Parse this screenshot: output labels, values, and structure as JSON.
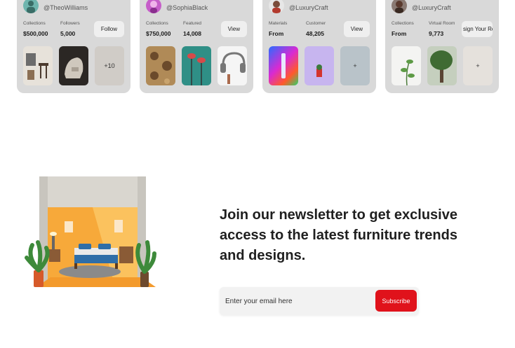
{
  "cards": [
    {
      "handle": "@TheoWilliams",
      "stats": [
        {
          "label": "Collections",
          "value": "$500,000"
        },
        {
          "label": "Followers",
          "value": "5,000"
        }
      ],
      "action": "Follow",
      "more": "+10"
    },
    {
      "handle": "@SophiaBlack",
      "stats": [
        {
          "label": "Collections",
          "value": "$750,000"
        },
        {
          "label": "Featured",
          "value": "14,008"
        }
      ],
      "action": "View"
    },
    {
      "handle": "@LuxuryCraft",
      "stats": [
        {
          "label": "Materials",
          "value": "From"
        },
        {
          "label": "Customer",
          "value": "48,205"
        }
      ],
      "action": "View",
      "more": "+"
    },
    {
      "handle": "@LuxuryCraft",
      "stats": [
        {
          "label": "Collections",
          "value": "From"
        },
        {
          "label": "Virtual Room",
          "value": "9,773"
        }
      ],
      "action": "sign Your Ro",
      "more": "+"
    }
  ],
  "newsletter": {
    "title": "Join our newsletter to get exclusive access to the latest furniture trends and designs.",
    "placeholder": "Enter your email here",
    "button": "Subscribe"
  },
  "colors": {
    "card_bg": "#d9d9d9",
    "accent": "#e0121b",
    "wall": "#f7a93a"
  }
}
